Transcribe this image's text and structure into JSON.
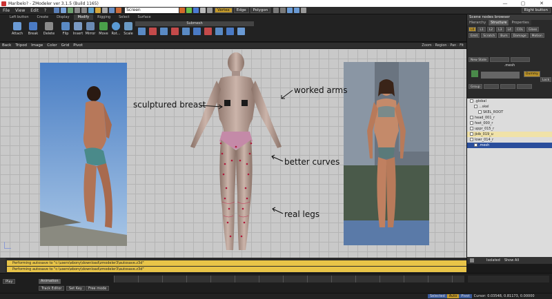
{
  "window": {
    "title": "Maribelo? - ZModeler ver 3.1.5 (Build 1165)",
    "minimize": "—",
    "maximize": "▢",
    "close": "✕"
  },
  "menu": {
    "items": [
      "File",
      "View",
      "Edit",
      "?"
    ],
    "screen_field": "Screen",
    "modes": [
      "Vertex",
      "Edge",
      "Polygon"
    ],
    "right_button": "Right button"
  },
  "ribbon": {
    "mode_label": "Left button",
    "tabs": [
      "Create",
      "Display",
      "Modify",
      "Rigging",
      "Select",
      "Surface"
    ],
    "active_tab": "Modify",
    "tools": [
      "Attach",
      "Break",
      "Delete",
      "Flip",
      "Insert",
      "Mirror",
      "Move",
      "Rot...",
      "Scale"
    ],
    "submesh_label": "Submesh"
  },
  "viewport_bar": {
    "items": [
      "Back",
      "Tripod",
      "Image",
      "Color",
      "Grid",
      "Pivot"
    ],
    "right": "Zoom · Region · Pan · Fit"
  },
  "annotations": {
    "breast": "sculptured breast",
    "arms": "worked arms",
    "curves": "better curves",
    "legs": "real legs"
  },
  "right_panel": {
    "header": "Scene nodes browser",
    "tabs": [
      "Hierarchy",
      "Structure",
      "Properties"
    ],
    "active_tab": "Structure",
    "buttons_row1": [
      "L0",
      "L1",
      "L2",
      "L3",
      "L4",
      "COL",
      "Glass",
      "Emit"
    ],
    "buttons_row2": [
      "Scratch",
      "Bum",
      "Damage",
      "Motion"
    ],
    "new_state": "New State",
    "mesh_label": ".mesh",
    "group_label": "Group",
    "dummy_label": "Dummy",
    "lock_label": "Lock",
    "tree": [
      ".global",
      "...skel",
      "SKEL_ROOT",
      "head_001_r",
      "feet_000_r",
      "uppr_015_r",
      "jbib_019_u",
      "lowr_014_r",
      ".mesh"
    ],
    "isolated": "Isolated",
    "show_all": "Show All"
  },
  "log": {
    "line1": "Performing autosave to \"c:\\users\\ebony\\download\\zmodeler3\\autosave.z3d\"",
    "line2": "Performing autosave to \"c:\\users\\ebony\\download\\zmodeler3\\autosave.z3d\""
  },
  "animation": {
    "label": "Animation",
    "track_editor": "Track Editor",
    "set_key": "Set Key",
    "free_mode": "Free mode",
    "play": "Play"
  },
  "status": {
    "selected": "Selected",
    "auto": "Auto",
    "pivot": "Pivot",
    "cursor": "Cursor: 0.03548, 0.81173, 0.00000"
  },
  "colors": {
    "accent": "#c49a2a",
    "log": "#e8c448",
    "viewport": "#c9c9c9"
  }
}
